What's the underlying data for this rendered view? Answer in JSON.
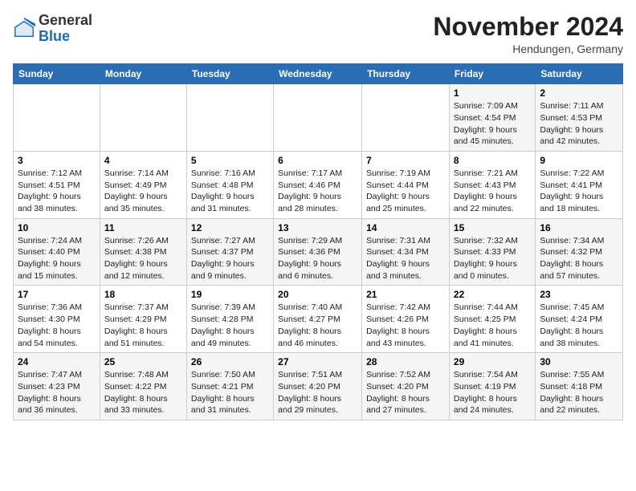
{
  "header": {
    "logo_general": "General",
    "logo_blue": "Blue",
    "month_title": "November 2024",
    "location": "Hendungen, Germany"
  },
  "days_of_week": [
    "Sunday",
    "Monday",
    "Tuesday",
    "Wednesday",
    "Thursday",
    "Friday",
    "Saturday"
  ],
  "weeks": [
    [
      {
        "day": "",
        "info": ""
      },
      {
        "day": "",
        "info": ""
      },
      {
        "day": "",
        "info": ""
      },
      {
        "day": "",
        "info": ""
      },
      {
        "day": "",
        "info": ""
      },
      {
        "day": "1",
        "info": "Sunrise: 7:09 AM\nSunset: 4:54 PM\nDaylight: 9 hours and 45 minutes."
      },
      {
        "day": "2",
        "info": "Sunrise: 7:11 AM\nSunset: 4:53 PM\nDaylight: 9 hours and 42 minutes."
      }
    ],
    [
      {
        "day": "3",
        "info": "Sunrise: 7:12 AM\nSunset: 4:51 PM\nDaylight: 9 hours and 38 minutes."
      },
      {
        "day": "4",
        "info": "Sunrise: 7:14 AM\nSunset: 4:49 PM\nDaylight: 9 hours and 35 minutes."
      },
      {
        "day": "5",
        "info": "Sunrise: 7:16 AM\nSunset: 4:48 PM\nDaylight: 9 hours and 31 minutes."
      },
      {
        "day": "6",
        "info": "Sunrise: 7:17 AM\nSunset: 4:46 PM\nDaylight: 9 hours and 28 minutes."
      },
      {
        "day": "7",
        "info": "Sunrise: 7:19 AM\nSunset: 4:44 PM\nDaylight: 9 hours and 25 minutes."
      },
      {
        "day": "8",
        "info": "Sunrise: 7:21 AM\nSunset: 4:43 PM\nDaylight: 9 hours and 22 minutes."
      },
      {
        "day": "9",
        "info": "Sunrise: 7:22 AM\nSunset: 4:41 PM\nDaylight: 9 hours and 18 minutes."
      }
    ],
    [
      {
        "day": "10",
        "info": "Sunrise: 7:24 AM\nSunset: 4:40 PM\nDaylight: 9 hours and 15 minutes."
      },
      {
        "day": "11",
        "info": "Sunrise: 7:26 AM\nSunset: 4:38 PM\nDaylight: 9 hours and 12 minutes."
      },
      {
        "day": "12",
        "info": "Sunrise: 7:27 AM\nSunset: 4:37 PM\nDaylight: 9 hours and 9 minutes."
      },
      {
        "day": "13",
        "info": "Sunrise: 7:29 AM\nSunset: 4:36 PM\nDaylight: 9 hours and 6 minutes."
      },
      {
        "day": "14",
        "info": "Sunrise: 7:31 AM\nSunset: 4:34 PM\nDaylight: 9 hours and 3 minutes."
      },
      {
        "day": "15",
        "info": "Sunrise: 7:32 AM\nSunset: 4:33 PM\nDaylight: 9 hours and 0 minutes."
      },
      {
        "day": "16",
        "info": "Sunrise: 7:34 AM\nSunset: 4:32 PM\nDaylight: 8 hours and 57 minutes."
      }
    ],
    [
      {
        "day": "17",
        "info": "Sunrise: 7:36 AM\nSunset: 4:30 PM\nDaylight: 8 hours and 54 minutes."
      },
      {
        "day": "18",
        "info": "Sunrise: 7:37 AM\nSunset: 4:29 PM\nDaylight: 8 hours and 51 minutes."
      },
      {
        "day": "19",
        "info": "Sunrise: 7:39 AM\nSunset: 4:28 PM\nDaylight: 8 hours and 49 minutes."
      },
      {
        "day": "20",
        "info": "Sunrise: 7:40 AM\nSunset: 4:27 PM\nDaylight: 8 hours and 46 minutes."
      },
      {
        "day": "21",
        "info": "Sunrise: 7:42 AM\nSunset: 4:26 PM\nDaylight: 8 hours and 43 minutes."
      },
      {
        "day": "22",
        "info": "Sunrise: 7:44 AM\nSunset: 4:25 PM\nDaylight: 8 hours and 41 minutes."
      },
      {
        "day": "23",
        "info": "Sunrise: 7:45 AM\nSunset: 4:24 PM\nDaylight: 8 hours and 38 minutes."
      }
    ],
    [
      {
        "day": "24",
        "info": "Sunrise: 7:47 AM\nSunset: 4:23 PM\nDaylight: 8 hours and 36 minutes."
      },
      {
        "day": "25",
        "info": "Sunrise: 7:48 AM\nSunset: 4:22 PM\nDaylight: 8 hours and 33 minutes."
      },
      {
        "day": "26",
        "info": "Sunrise: 7:50 AM\nSunset: 4:21 PM\nDaylight: 8 hours and 31 minutes."
      },
      {
        "day": "27",
        "info": "Sunrise: 7:51 AM\nSunset: 4:20 PM\nDaylight: 8 hours and 29 minutes."
      },
      {
        "day": "28",
        "info": "Sunrise: 7:52 AM\nSunset: 4:20 PM\nDaylight: 8 hours and 27 minutes."
      },
      {
        "day": "29",
        "info": "Sunrise: 7:54 AM\nSunset: 4:19 PM\nDaylight: 8 hours and 24 minutes."
      },
      {
        "day": "30",
        "info": "Sunrise: 7:55 AM\nSunset: 4:18 PM\nDaylight: 8 hours and 22 minutes."
      }
    ]
  ]
}
